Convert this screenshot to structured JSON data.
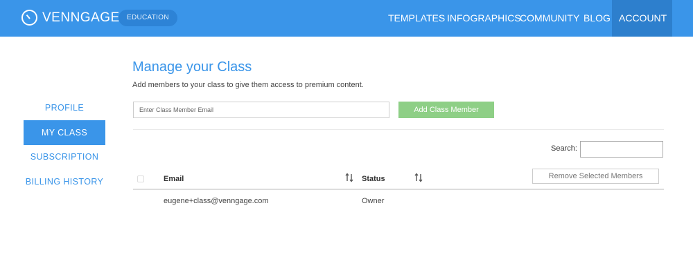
{
  "header": {
    "brand": "VENNGAGE",
    "badge": "EDUCATION",
    "nav": [
      "TEMPLATES",
      "INFOGRAPHICS",
      "COMMUNITY",
      "BLOG"
    ],
    "account": "ACCOUNT",
    "bg_color": "#3a95e9"
  },
  "sidebar": {
    "items": [
      {
        "label": "PROFILE"
      },
      {
        "label": "MY CLASS"
      },
      {
        "label": "SUBSCRIPTION"
      },
      {
        "label": "BILLING HISTORY"
      }
    ],
    "active_index": 1
  },
  "main": {
    "title": "Manage your Class",
    "subtitle": "Add members to your class to give them access to premium content.",
    "email_placeholder": "Enter Class Member Email",
    "add_button": "Add Class Member",
    "search_label": "Search:",
    "remove_button": "Remove Selected Members",
    "table": {
      "columns": [
        "Email",
        "Status"
      ],
      "rows": [
        {
          "email": "eugene+class@venngage.com",
          "status": "Owner"
        }
      ]
    }
  },
  "icons": {
    "logo": "clock-icon",
    "sort": "sort-arrows-icon",
    "checkbox": "checkbox-icon",
    "caret": "caret-down-icon"
  }
}
